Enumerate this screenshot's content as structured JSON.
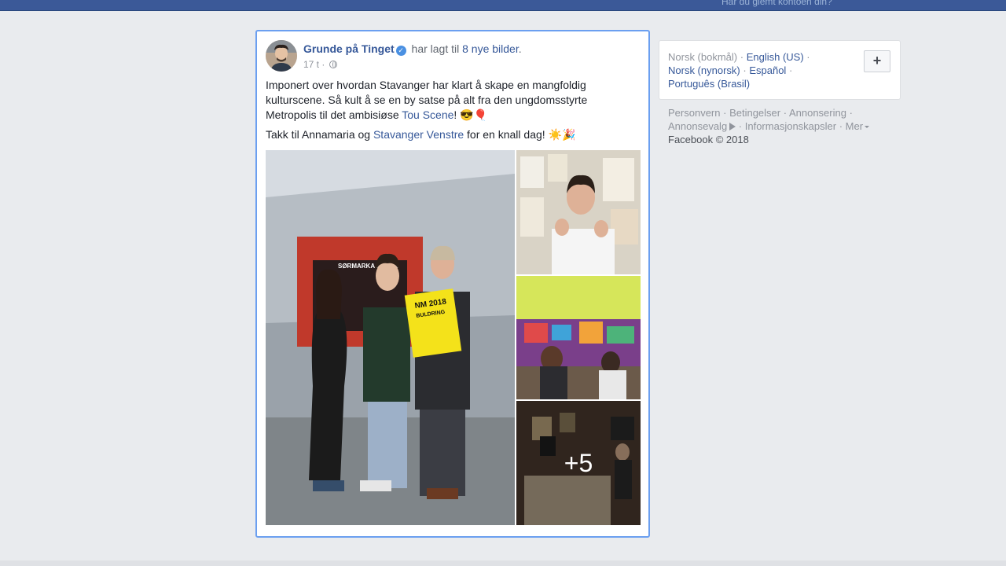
{
  "topbar": {
    "forgot_account": "Har du glemt kontoen din?"
  },
  "post": {
    "author": "Grunde på Tinget",
    "verified_icon": "verified-badge-icon",
    "action_text": "har lagt til",
    "action_link": "8 nye bilder",
    "action_suffix": ".",
    "time": "17 t",
    "privacy_icon": "globe-icon",
    "text_p1_before": "Imponert over hvordan Stavanger har klart å skape en mangfoldig kulturscene. Så kult å se en by satse på alt fra den ungdomsstyrte Metropolis til det ambisiøse ",
    "text_p1_link": "Tou Scene",
    "text_p1_after": "! 😎🎈",
    "text_p2_before": "Takk til Annamaria og ",
    "text_p2_link": "Stavanger Venstre",
    "text_p2_after": " for en knall dag! ☀️🎉",
    "photo_sign_text": "SØRMARKA ARENA",
    "photo_poster_text": "NM 2018",
    "photo_poster_sub": "BULDRING",
    "more_photos": "+5"
  },
  "sidebar": {
    "languages": {
      "current": "Norsk (bokmål)",
      "links": [
        "English (US)",
        "Norsk (nynorsk)",
        "Español",
        "Português (Brasil)"
      ],
      "add_button": "+"
    },
    "footer": {
      "links": [
        "Personvern",
        "Betingelser",
        "Annonsering",
        "Annonsevalg",
        "Informasjonskapsler",
        "Mer"
      ],
      "copyright": "Facebook © 2018"
    }
  },
  "colors": {
    "brand_blue": "#3b5998",
    "link_blue": "#365899",
    "focus_border": "#6b9ff0",
    "page_bg": "#e9ebee"
  }
}
